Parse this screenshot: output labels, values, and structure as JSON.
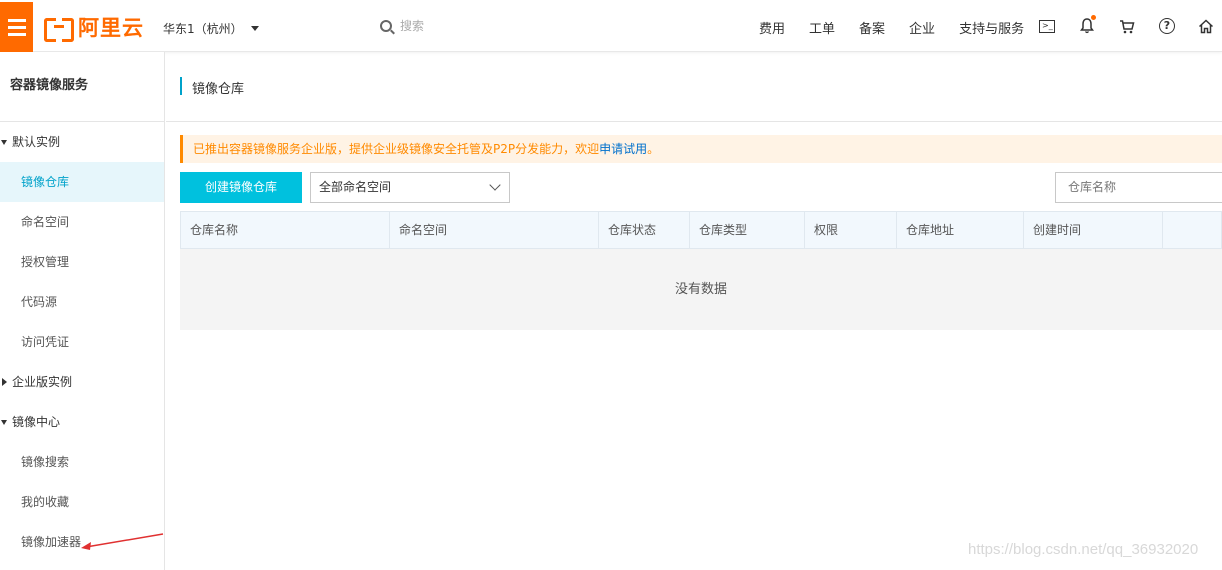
{
  "topbar": {
    "logo_text": "阿里云",
    "region": "华东1（杭州）",
    "search_placeholder": "搜索",
    "nav": [
      "费用",
      "工单",
      "备案",
      "企业",
      "支持与服务"
    ]
  },
  "sidebar": {
    "title": "容器镜像服务",
    "items": [
      {
        "label": "默认实例",
        "type": "group-open"
      },
      {
        "label": "镜像仓库",
        "type": "sub",
        "active": true
      },
      {
        "label": "命名空间",
        "type": "sub"
      },
      {
        "label": "授权管理",
        "type": "sub"
      },
      {
        "label": "代码源",
        "type": "sub"
      },
      {
        "label": "访问凭证",
        "type": "sub"
      },
      {
        "label": "企业版实例",
        "type": "group-closed"
      },
      {
        "label": "镜像中心",
        "type": "group-open"
      },
      {
        "label": "镜像搜索",
        "type": "sub"
      },
      {
        "label": "我的收藏",
        "type": "sub"
      },
      {
        "label": "镜像加速器",
        "type": "sub"
      }
    ]
  },
  "main": {
    "page_title": "镜像仓库",
    "notice_text": "已推出容器镜像服务企业版，提供企业级镜像安全托管及P2P分发能力，欢迎",
    "notice_link": "申请试用",
    "notice_end": "。",
    "create_button": "创建镜像仓库",
    "namespace_select": "全部命名空间",
    "repo_name_placeholder": "仓库名称",
    "table": {
      "columns": [
        "仓库名称",
        "命名空间",
        "仓库状态",
        "仓库类型",
        "权限",
        "仓库地址",
        "创建时间",
        ""
      ],
      "empty_text": "没有数据"
    }
  },
  "watermark": "https://blog.csdn.net/qq_36932020",
  "colors": {
    "brand": "#ff6a00",
    "accent": "#00c1de",
    "active_text": "#00a2ca",
    "notice_text": "#ff8a00",
    "annotation_arrow": "#e03030"
  }
}
